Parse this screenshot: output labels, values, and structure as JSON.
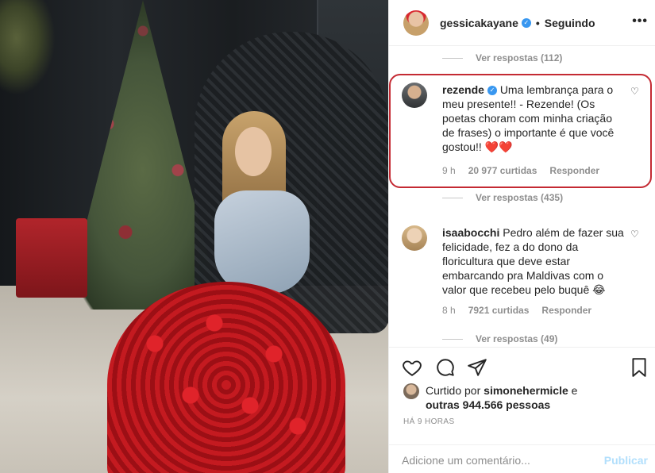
{
  "post": {
    "owner": "gessicakayane",
    "separator": "•",
    "follow_status": "Seguindo",
    "more_icon": "more-icon"
  },
  "comments": {
    "view_replies_1": "Ver respostas (112)",
    "items": [
      {
        "user": "rezende",
        "text": "Uma lembrança para o meu presente!! - Rezende! (Os poetas choram com minha criação de frases) o importante é que você gostou!!",
        "emoji": "❤️❤️",
        "age": "9 h",
        "likes": "20 977 curtidas",
        "reply": "Responder"
      },
      {
        "user": "isaabocchi",
        "text": "Pedro além de fazer sua felicidade, fez a do dono da floricultura que deve estar embarcando pra Maldivas com o valor que recebeu pelo buquê",
        "emoji": "😂",
        "age": "8 h",
        "likes": "7921 curtidas",
        "reply": "Responder"
      }
    ],
    "view_replies_2": "Ver respostas (435)",
    "view_replies_3": "Ver respostas (49)"
  },
  "likes": {
    "prefix": "Curtido por",
    "user": "simonehermicle",
    "suffix": "e",
    "others": "outras 944.566 pessoas"
  },
  "time": "HÁ 9 HORAS",
  "add_comment": {
    "placeholder": "Adicione um comentário...",
    "publish": "Publicar"
  },
  "colors": {
    "highlight_border": "#c42a33",
    "verified": "#3897f0",
    "publish_disabled": "#b2dffc",
    "heart": "#ed4956"
  }
}
